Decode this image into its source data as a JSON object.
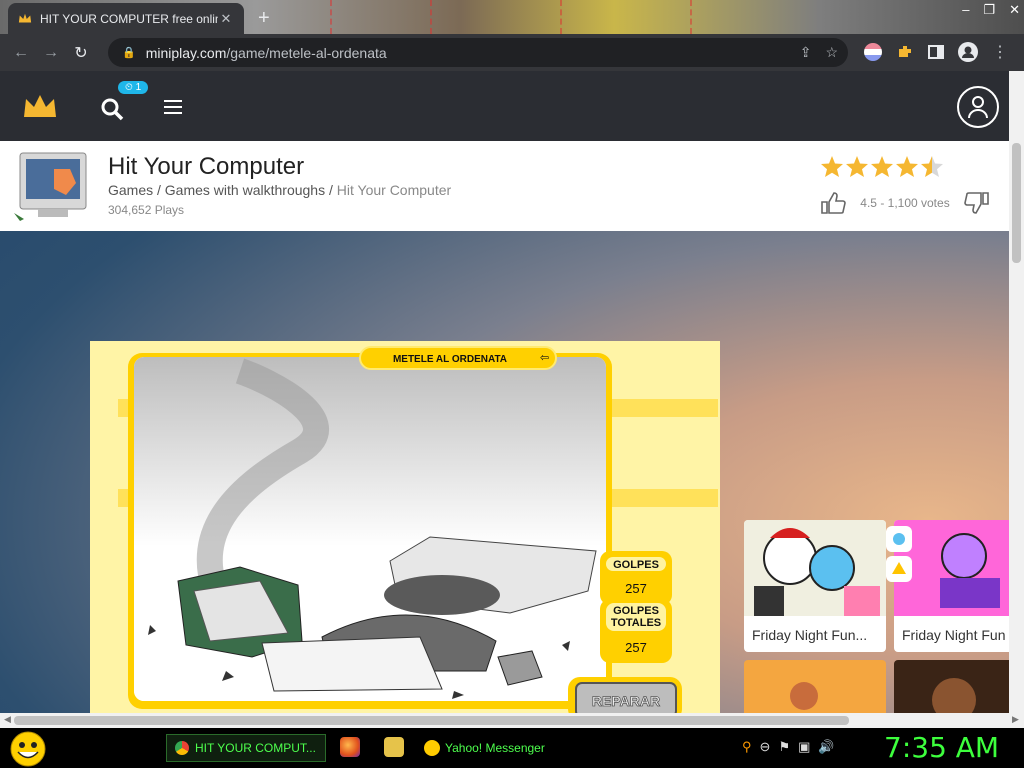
{
  "browser": {
    "tab_title": "HIT YOUR COMPUTER free online",
    "tab_close": "✕",
    "new_tab": "+",
    "url_host": "miniplay.com",
    "url_path": "/game/metele-al-ordenata",
    "icons": [
      "back-icon",
      "forward-icon",
      "reload-icon",
      "lock-icon",
      "share-icon",
      "star-icon",
      "extension-icon",
      "puzzle-icon",
      "sidebar-icon",
      "profile-icon",
      "menu-icon"
    ]
  },
  "site": {
    "notification_count": "⏲ 1"
  },
  "game": {
    "title": "Hit Your Computer",
    "breadcrumb": {
      "games": "Games",
      "sep1": " / ",
      "category": "Games with walkthroughs",
      "sep2": " / ",
      "current": "Hit Your Computer"
    },
    "plays": "304,652 Plays",
    "rating_text": "4.5 - 1,100 votes",
    "rating_value": 4.5,
    "stars_max": 5
  },
  "flash_game": {
    "banner": "METELE AL ORDENATA",
    "golpes_label": "GOLPES",
    "golpes_value": "257",
    "golpes_totales_label_1": "GOLPES",
    "golpes_totales_label_2": "TOTALES",
    "golpes_totales_value": "257",
    "repair_button": "REPARAR"
  },
  "related": [
    {
      "label": "Friday Night Fun..."
    },
    {
      "label": "Friday Night Fun"
    }
  ],
  "taskbar": {
    "chrome_task": "HIT YOUR COMPUT...",
    "yahoo_task": "Yahoo! Messenger",
    "clock": "7:35 AM"
  },
  "colors": {
    "accent_blue": "#1fb6e9",
    "star_gold": "#f5b731",
    "header_dark": "#2b2d33",
    "clock_green": "#3dff3d"
  }
}
